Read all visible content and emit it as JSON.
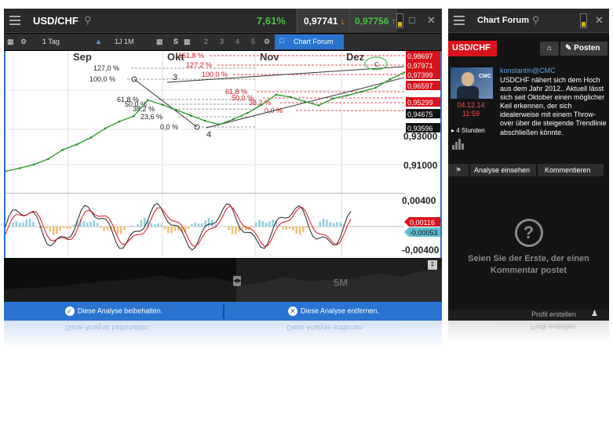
{
  "chart_window": {
    "symbol": "USD/CHF",
    "change": "7,61%",
    "sell": "0,97741",
    "buy": "0,97756",
    "toolbar": {
      "timeframe": "1 Tag",
      "range": "1J 1M",
      "s_label": "S",
      "pages": [
        "2",
        "3",
        "4",
        "5"
      ],
      "chart_forum": "Chart Forum"
    },
    "x_axis": [
      "Sep",
      "Okt",
      "Nov",
      "Dez"
    ],
    "price_labels": [
      "0,98697",
      "0,97971",
      "0,97399",
      "0,96597",
      "0,95299",
      "0,94675",
      "0,93596"
    ],
    "price_ticks": [
      "0,93000",
      "0,91000"
    ],
    "fib_levels": [
      {
        "label": "127,0 %"
      },
      {
        "label": "100,0 %"
      },
      {
        "label": "61,8 %"
      },
      {
        "label": "50,0 %"
      },
      {
        "label": "38,2 %"
      },
      {
        "label": "23,6 %"
      },
      {
        "label": "0,0 %"
      }
    ],
    "fib_levels_red": [
      {
        "label": "161,8 %"
      },
      {
        "label": "127,2 %"
      },
      {
        "label": "100,0 %"
      },
      {
        "label": "61,8 %"
      },
      {
        "label": "50,0 %"
      },
      {
        "label": "38,2 %"
      },
      {
        "label": "0,0 %"
      }
    ],
    "wave_labels": [
      "3",
      "4",
      "C"
    ],
    "osc_ticks": [
      "0,00400",
      "-0,00400"
    ],
    "osc_values": [
      "0,00116",
      "-0,00053"
    ],
    "navigator_label": "5M",
    "keep_label": "Diese Analyse beibehalten.",
    "remove_label": "Diese Analyse entfernen.",
    "colors": {
      "accent": "#2a73d1",
      "up": "#49c04a",
      "down": "#d8131b",
      "price_line": "#2aa02a"
    }
  },
  "forum": {
    "title": "Chart Forum",
    "tag": "USD/CHF",
    "post_label": "Posten",
    "author": "konstantin@CMC",
    "date": "04.12.14",
    "time": "11:59",
    "interval": "4 Stunden",
    "text": "USDCHF nähert sich dem Hoch aus dem Jahr 2012.. Aktuell lässt sich seit Oktober einen möglicher Keil erkennen, der sich idealerweise mit einem Throw-over über die steigende Trendlinie abschließen könnte.",
    "analyse_label": "Analyse einsehen",
    "comment_label": "Kommentieren",
    "empty_message": "Seien Sie der Erste, der einen Kommentar postet",
    "profile_label": "Profil erstellen"
  },
  "chart_data": {
    "type": "line",
    "ylim": [
      0.9,
      0.99
    ],
    "x": [
      "Sep",
      "Okt",
      "Nov",
      "Dez"
    ],
    "series": [
      {
        "values": [
          0.9125,
          0.9145,
          0.917,
          0.9205,
          0.9265,
          0.93,
          0.9345,
          0.9405,
          0.945,
          0.9485,
          0.959,
          0.956,
          0.9525,
          0.949,
          0.9455,
          0.943,
          0.9465,
          0.9505,
          0.956,
          0.9625,
          0.961,
          0.958,
          0.9555,
          0.96,
          0.962,
          0.9645,
          0.967,
          0.9725,
          0.977
        ]
      }
    ]
  }
}
